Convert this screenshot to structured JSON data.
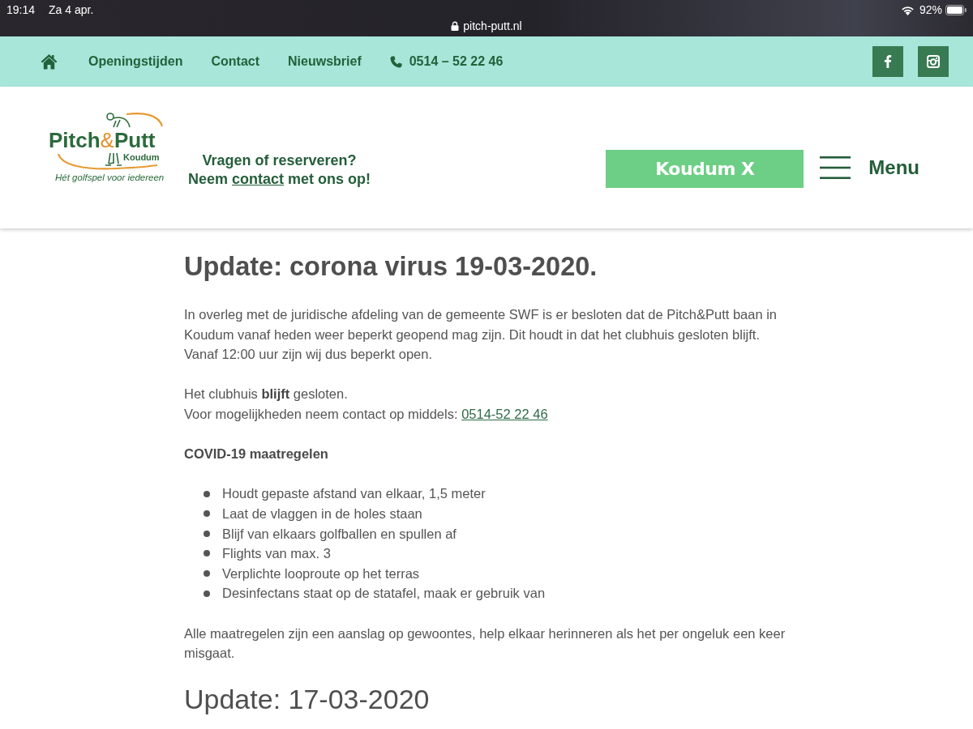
{
  "status_bar": {
    "time": "19:14",
    "date": "Za 4 apr.",
    "address": "pitch-putt.nl",
    "battery": "92%"
  },
  "top_nav": {
    "links": [
      {
        "label": "Openingstijden"
      },
      {
        "label": "Contact"
      },
      {
        "label": "Nieuwsbrief"
      }
    ],
    "phone": "0514 – 52 22 46"
  },
  "header": {
    "logo": {
      "wordmark_start": "Pitch",
      "wordmark_amp": "&",
      "wordmark_end": "Putt",
      "place": "Koudum",
      "slogan": "Hét golfspel voor iedereen"
    },
    "prompt": {
      "question": "Vragen of reserveren?",
      "before_link": "Neem",
      "link": "contact",
      "after_link": "met ons op!"
    },
    "button": "Koudum X",
    "menu": "Menu"
  },
  "article": {
    "title": "Update: corona virus 19-03-2020.",
    "intro": "In overleg met de juridische afdeling van de gemeente SWF is er besloten dat de Pitch&Putt baan in Koudum vanaf heden weer beperkt geopend mag zijn. Dit houdt in dat het clubhuis gesloten blijft.\nVanaf 12:00 uur zijn wij dus beperkt open.",
    "notice": "Het clubhuis **blijft** gesloten.",
    "contact": {
      "text": "Voor mogelijkheden neem contact op middels:",
      "phone": "0514-52 22 46"
    },
    "measures_title": "COVID-19 maatregelen",
    "measures": [
      "Houdt gepaste afstand van elkaar, 1,5 meter",
      "Laat de vlaggen in de holes staan",
      "Blijf van elkaars golfballen en spullen af",
      "Flights van max. 3",
      "Verplichte looproute op het terras",
      "Desinfectans staat op de statafel, maak er gebruik van"
    ],
    "closing": "Alle maatregelen zijn een aanslag op gewoontes, help elkaar herinneren als het per ongeluk een keer misgaat.",
    "next_title": "Update: 17-03-2020"
  }
}
